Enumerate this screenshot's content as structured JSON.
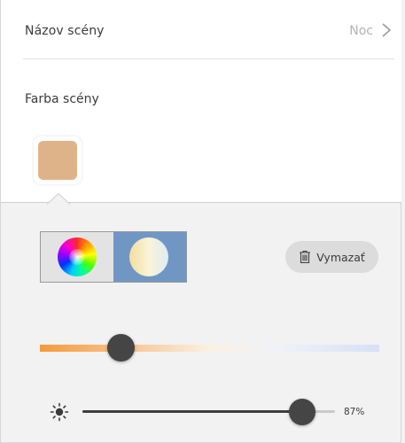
{
  "scene": {
    "name_label": "Názov scény",
    "name_value": "Noc",
    "color_label": "Farba scény",
    "swatch_color": "#dfb389"
  },
  "controls": {
    "mode_options": [
      "color-wheel-icon",
      "white-temperature-icon"
    ],
    "selected_mode": "white-temperature-icon",
    "clear_label": "Vymazať",
    "temperature_level": 0.24,
    "brightness_percent": 87,
    "brightness_label": "87%"
  },
  "colors": {
    "accent": "#7097c4",
    "knob": "#454545",
    "temperature_warm": "#f59a3b",
    "temperature_cool": "#d6e1f6"
  }
}
